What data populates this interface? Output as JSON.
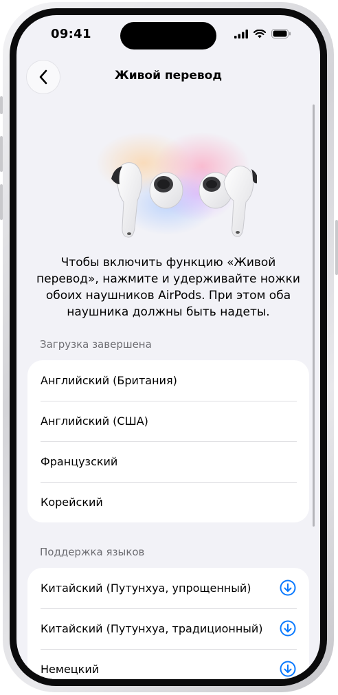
{
  "status_bar": {
    "time": "09:41"
  },
  "nav": {
    "title": "Живой перевод"
  },
  "description": "Чтобы включить функцию «Живой перевод», нажмите и удерживайте ножки обоих наушников AirPods. При этом оба наушника должны быть надеты.",
  "downloaded": {
    "header": "Загрузка завершена",
    "items": [
      {
        "label": "Английский (Британия)"
      },
      {
        "label": "Английский (США)"
      },
      {
        "label": "Французский"
      },
      {
        "label": "Корейский"
      }
    ]
  },
  "supported": {
    "header": "Поддержка языков",
    "items": [
      {
        "label": "Китайский (Путунхуа, упрощенный)",
        "icon": "download-icon"
      },
      {
        "label": "Китайский (Путунхуа, традиционный)",
        "icon": "download-icon"
      },
      {
        "label": "Немецкий",
        "icon": "download-icon"
      }
    ]
  },
  "colors": {
    "accent": "#0a7aff",
    "background": "#f2f2f7"
  }
}
